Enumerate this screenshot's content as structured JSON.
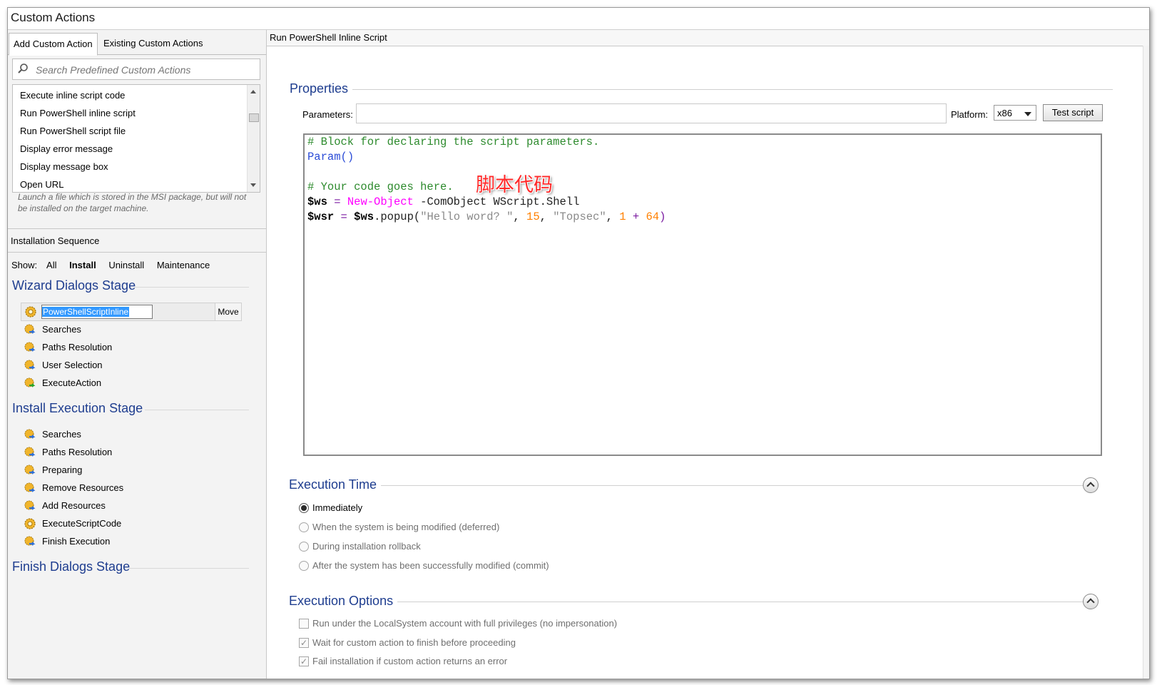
{
  "window": {
    "title": "Custom Actions"
  },
  "left": {
    "tabs": [
      {
        "label": "Add Custom Action",
        "active": true
      },
      {
        "label": "Existing Custom Actions",
        "active": false
      }
    ],
    "search": {
      "placeholder": "Search Predefined Custom Actions",
      "value": ""
    },
    "predefined": [
      "Execute inline script code",
      "Run PowerShell inline script",
      "Run PowerShell script file",
      "Display error message",
      "Display message box",
      "Open URL"
    ],
    "description": "Launch a file which is stored in the MSI package, but will not be installed on the target machine.",
    "sequence_header": "Installation Sequence",
    "show": {
      "label": "Show:",
      "options": [
        "All",
        "Install",
        "Uninstall",
        "Maintenance"
      ],
      "selected": "Install"
    },
    "stages": {
      "wizard": {
        "title": "Wizard Dialogs Stage",
        "editing_item": "PowerShellScriptInline",
        "move_label": "Move",
        "items": [
          "Searches",
          "Paths Resolution",
          "User Selection",
          "ExecuteAction"
        ]
      },
      "install": {
        "title": "Install Execution Stage",
        "items": [
          "Searches",
          "Paths Resolution",
          "Preparing",
          "Remove Resources",
          "Add Resources",
          "ExecuteScriptCode",
          "Finish Execution"
        ]
      },
      "finish": {
        "title": "Finish Dialogs Stage"
      }
    }
  },
  "right": {
    "header": "Run PowerShell Inline Script",
    "properties": {
      "title": "Properties",
      "parameters_label": "Parameters:",
      "parameters_value": "",
      "platform_label": "Platform:",
      "platform_value": "x86",
      "test_button": "Test script"
    },
    "code": {
      "line1": "# Block for declaring the script parameters.",
      "line2_kw": "Param",
      "line2_rest": "()",
      "line4": "# Your code goes here.",
      "line5": {
        "var": "$ws",
        "eq": "=",
        "cmd": "New-Object",
        "rest": " -ComObject WScript.Shell"
      },
      "line6": {
        "var": "$wsr",
        "eq": "=",
        "var2": "$ws",
        "method": ".popup(",
        "str1": "\"Hello word? \"",
        "comma1": ", ",
        "num1": "15",
        "comma2": ", ",
        "str2": "\"Topsec\"",
        "comma3": ", ",
        "num2": "1",
        "plus": " + ",
        "num3": "64",
        "close": ")"
      }
    },
    "annotation": "脚本代码",
    "execution_time": {
      "title": "Execution Time",
      "options": [
        {
          "label": "Immediately",
          "checked": true
        },
        {
          "label": "When the system is being modified (deferred)",
          "checked": false
        },
        {
          "label": "During installation rollback",
          "checked": false
        },
        {
          "label": "After the system has been successfully modified (commit)",
          "checked": false
        }
      ]
    },
    "execution_options": {
      "title": "Execution Options",
      "options": [
        {
          "label": "Run under the LocalSystem account with full privileges (no impersonation)",
          "checked": false
        },
        {
          "label": "Wait for custom action to finish before proceeding",
          "checked": true
        },
        {
          "label": "Fail installation if custom action returns an error",
          "checked": true
        }
      ]
    }
  },
  "colors": {
    "stage_title": "#1e3d8f",
    "comment": "#2e8b2e",
    "keyword": "#2a4bd7",
    "cmdlet": "#ff00ff",
    "number": "#ff8000",
    "string": "#8a8a8a",
    "annotation": "#ff2a2a",
    "selection": "#3399ff"
  }
}
